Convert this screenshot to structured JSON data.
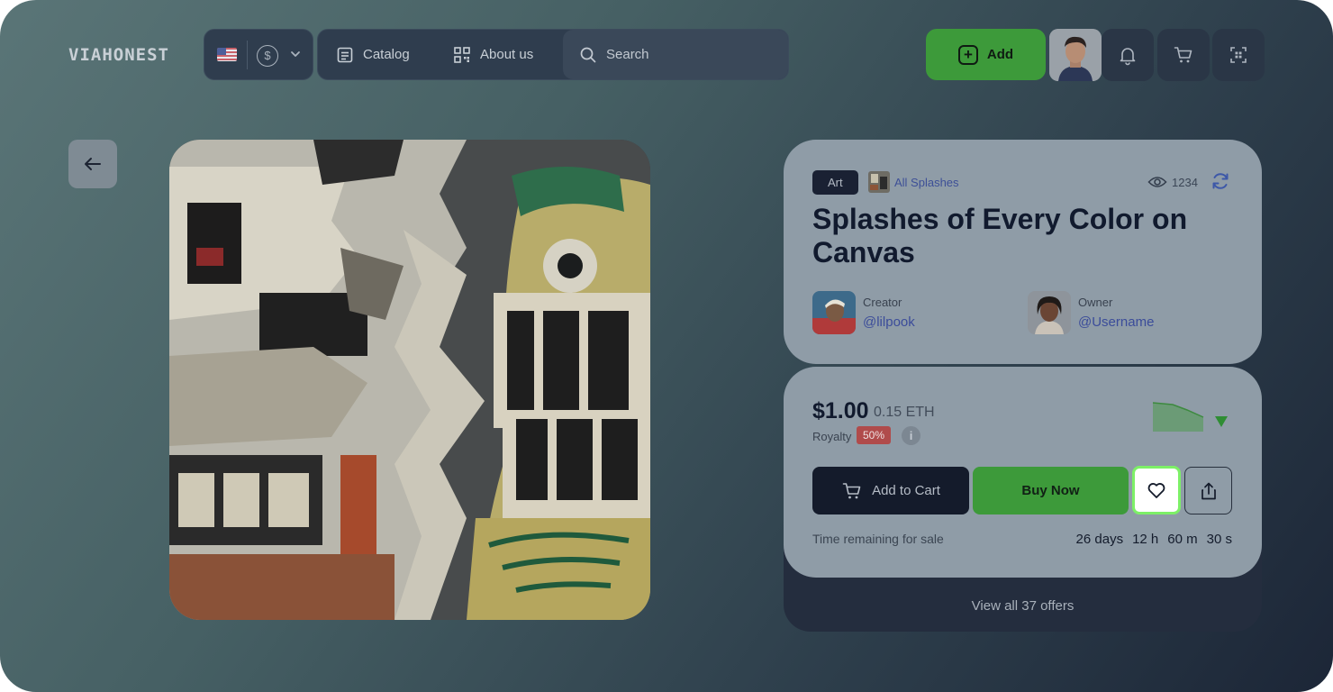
{
  "header": {
    "logo": "VIAHONEST",
    "locale": {
      "flag": "us-flag",
      "currency_symbol": "$"
    },
    "nav": [
      {
        "label": "Catalog",
        "icon": "catalog-icon"
      },
      {
        "label": "About us",
        "icon": "qr-icon"
      }
    ],
    "search": {
      "placeholder": "Search",
      "value": ""
    },
    "add_label": "Add",
    "icons": [
      "bell-icon",
      "cart-icon",
      "scan-icon"
    ]
  },
  "nft": {
    "category": "Art",
    "collection": "All Splashes",
    "views": "1234",
    "title": "Splashes of Every Color on Canvas",
    "creator": {
      "role": "Creator",
      "handle": "@lilpook"
    },
    "owner": {
      "role": "Owner",
      "handle": "@Username"
    }
  },
  "price": {
    "usd": "$1.00",
    "eth": "0.15 ETH",
    "royalty_label": "Royalty",
    "royalty_value": "50%",
    "info": "i",
    "trend": "down"
  },
  "actions": {
    "add_to_cart": "Add to Cart",
    "buy_now": "Buy Now"
  },
  "sale": {
    "label": "Time remaining for sale",
    "days": "26 days",
    "hours": "12 h",
    "minutes": "60 m",
    "seconds": "30 s"
  },
  "offers_link": "View all 37 offers",
  "colors": {
    "accent_green": "#3d9a3a",
    "like_outline": "#7df067",
    "link_blue": "#3b4c9a",
    "royalty_red": "#b04b4b"
  }
}
